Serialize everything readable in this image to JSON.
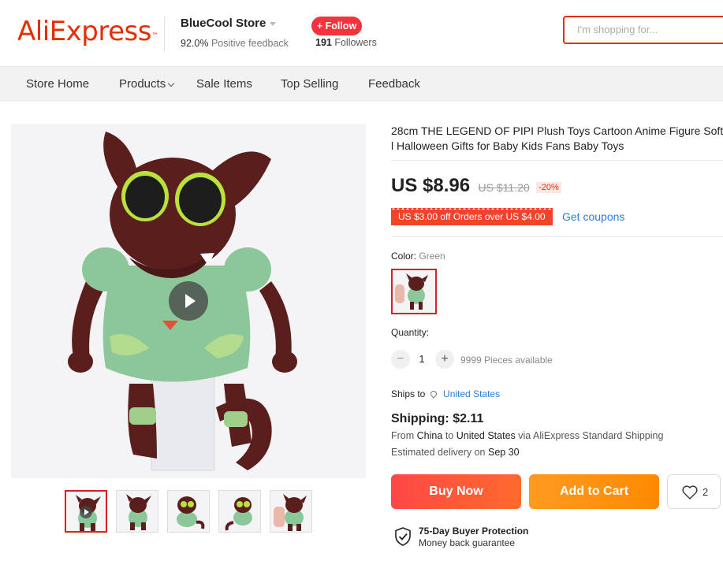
{
  "header": {
    "logo_text": "AliExpress",
    "store_name": "BlueCool Store",
    "feedback_pct": "92.0%",
    "feedback_label": "Positive feedback",
    "follow_label": "+ Follow",
    "followers_count": "191",
    "followers_label": "Followers",
    "search_placeholder": "I'm shopping for..."
  },
  "nav": {
    "items": [
      {
        "label": "Store Home"
      },
      {
        "label": "Products"
      },
      {
        "label": "Sale Items"
      },
      {
        "label": "Top Selling"
      },
      {
        "label": "Feedback"
      }
    ]
  },
  "product": {
    "title": "28cm THE LEGEND OF PIPI Plush Toys Cartoon Anime Figure Soft\nl Halloween Gifts for Baby Kids Fans Baby Toys",
    "price": "US $8.96",
    "original_price": "US $11.20",
    "discount": "-20%",
    "coupon_text": "US $3.00 off Orders over US $4.00",
    "get_coupons": "Get coupons",
    "color_label": "Color:",
    "color_value": "Green",
    "quantity_label": "Quantity:",
    "quantity_value": "1",
    "quantity_available": "9999 Pieces available",
    "ships_to_label": "Ships to",
    "ships_to_location": "United States",
    "shipping_title": "Shipping: $2.11",
    "shipping_from_prefix": "From",
    "shipping_origin": "China",
    "shipping_to_word": "to",
    "shipping_dest": "United States",
    "shipping_via": "via AliExpress Standard Shipping",
    "estimated_delivery_label": "Estimated delivery on",
    "estimated_delivery_date": "Sep 30",
    "buy_now": "Buy Now",
    "add_to_cart": "Add to Cart",
    "wishlist_count": "2",
    "protection_title": "75-Day Buyer Protection",
    "protection_sub": "Money back guarantee"
  },
  "colors": {
    "brand": "#e62e04",
    "follow": "#f5333f",
    "link": "#2b7ed8",
    "buy_now": "#ff4747",
    "add_to_cart": "#ff9a1f",
    "plush_brown": "#5a1f1c",
    "plush_green": "#8cc79a"
  },
  "icons": [
    "play-icon",
    "location-pin-icon",
    "heart-icon",
    "shield-check-icon",
    "chevron-down-icon"
  ]
}
